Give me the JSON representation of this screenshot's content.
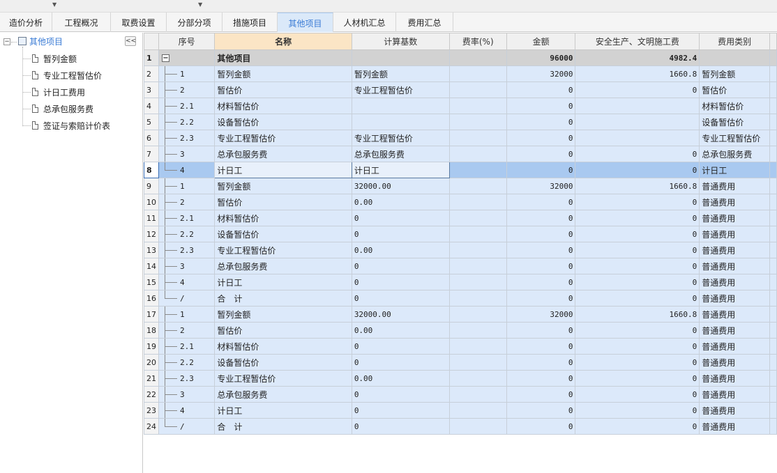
{
  "tabs": [
    {
      "label": "造价分析",
      "active": false
    },
    {
      "label": "工程概况",
      "active": false
    },
    {
      "label": "取费设置",
      "active": false
    },
    {
      "label": "分部分项",
      "active": false
    },
    {
      "label": "措施项目",
      "active": false
    },
    {
      "label": "其他项目",
      "active": true
    },
    {
      "label": "人材机汇总",
      "active": false
    },
    {
      "label": "费用汇总",
      "active": false
    }
  ],
  "tree": {
    "collapse_label": "<<",
    "root": {
      "label": "其他项目",
      "expander": "−"
    },
    "children": [
      "暂列金额",
      "专业工程暂估价",
      "计日工费用",
      "总承包服务费",
      "签证与索赔计价表"
    ]
  },
  "grid": {
    "columns": [
      "序号",
      "名称",
      "计算基数",
      "费率(%)",
      "金额",
      "安全生产、文明施工费",
      "费用类别"
    ],
    "header_row": {
      "row_no": "1",
      "expander": "−",
      "name": "其他项目",
      "amount": "96000",
      "safety": "4982.4"
    },
    "rows": [
      {
        "no": "2",
        "seq": "1",
        "name": "暂列金额",
        "base": "暂列金额",
        "rate": "",
        "amount": "32000",
        "safety": "1660.8",
        "category": "暂列金额"
      },
      {
        "no": "3",
        "seq": "2",
        "name": "暂估价",
        "base": "专业工程暂估价",
        "rate": "",
        "amount": "0",
        "safety": "0",
        "category": "暂估价"
      },
      {
        "no": "4",
        "seq": "2.1",
        "name": "材料暂估价",
        "base": "",
        "rate": "",
        "amount": "0",
        "safety": "",
        "category": "材料暂估价"
      },
      {
        "no": "5",
        "seq": "2.2",
        "name": "设备暂估价",
        "base": "",
        "rate": "",
        "amount": "0",
        "safety": "",
        "category": "设备暂估价"
      },
      {
        "no": "6",
        "seq": "2.3",
        "name": "专业工程暂估价",
        "base": "专业工程暂估价",
        "rate": "",
        "amount": "0",
        "safety": "",
        "category": "专业工程暂估价"
      },
      {
        "no": "7",
        "seq": "3",
        "name": "总承包服务费",
        "base": "总承包服务费",
        "rate": "",
        "amount": "0",
        "safety": "0",
        "category": "总承包服务费"
      },
      {
        "no": "8",
        "seq": "4",
        "name": "计日工",
        "base": "计日工",
        "rate": "",
        "amount": "0",
        "safety": "0",
        "category": "计日工"
      },
      {
        "no": "9",
        "seq": "1",
        "name": "暂列金额",
        "base": "32000.00",
        "rate": "",
        "amount": "32000",
        "safety": "1660.8",
        "category": "普通费用"
      },
      {
        "no": "10",
        "seq": "2",
        "name": "暂估价",
        "base": "0.00",
        "rate": "",
        "amount": "0",
        "safety": "0",
        "category": "普通费用"
      },
      {
        "no": "11",
        "seq": "2.1",
        "name": "材料暂估价",
        "base": "0",
        "rate": "",
        "amount": "0",
        "safety": "0",
        "category": "普通费用"
      },
      {
        "no": "12",
        "seq": "2.2",
        "name": "设备暂估价",
        "base": "0",
        "rate": "",
        "amount": "0",
        "safety": "0",
        "category": "普通费用"
      },
      {
        "no": "13",
        "seq": "2.3",
        "name": "专业工程暂估价",
        "base": "0.00",
        "rate": "",
        "amount": "0",
        "safety": "0",
        "category": "普通费用"
      },
      {
        "no": "14",
        "seq": "3",
        "name": "总承包服务费",
        "base": "0",
        "rate": "",
        "amount": "0",
        "safety": "0",
        "category": "普通费用"
      },
      {
        "no": "15",
        "seq": "4",
        "name": "计日工",
        "base": "0",
        "rate": "",
        "amount": "0",
        "safety": "0",
        "category": "普通费用"
      },
      {
        "no": "16",
        "seq": "/",
        "name": "合　计",
        "base": "0",
        "rate": "",
        "amount": "0",
        "safety": "0",
        "category": "普通费用"
      },
      {
        "no": "17",
        "seq": "1",
        "name": "暂列金额",
        "base": "32000.00",
        "rate": "",
        "amount": "32000",
        "safety": "1660.8",
        "category": "普通费用"
      },
      {
        "no": "18",
        "seq": "2",
        "name": "暂估价",
        "base": "0.00",
        "rate": "",
        "amount": "0",
        "safety": "0",
        "category": "普通费用"
      },
      {
        "no": "19",
        "seq": "2.1",
        "name": "材料暂估价",
        "base": "0",
        "rate": "",
        "amount": "0",
        "safety": "0",
        "category": "普通费用"
      },
      {
        "no": "20",
        "seq": "2.2",
        "name": "设备暂估价",
        "base": "0",
        "rate": "",
        "amount": "0",
        "safety": "0",
        "category": "普通费用"
      },
      {
        "no": "21",
        "seq": "2.3",
        "name": "专业工程暂估价",
        "base": "0.00",
        "rate": "",
        "amount": "0",
        "safety": "0",
        "category": "普通费用"
      },
      {
        "no": "22",
        "seq": "3",
        "name": "总承包服务费",
        "base": "0",
        "rate": "",
        "amount": "0",
        "safety": "0",
        "category": "普通费用"
      },
      {
        "no": "23",
        "seq": "4",
        "name": "计日工",
        "base": "0",
        "rate": "",
        "amount": "0",
        "safety": "0",
        "category": "普通费用"
      },
      {
        "no": "24",
        "seq": "/",
        "name": "合　计",
        "base": "0",
        "rate": "",
        "amount": "0",
        "safety": "0",
        "category": "普通费用"
      }
    ],
    "selected_row": "8"
  }
}
